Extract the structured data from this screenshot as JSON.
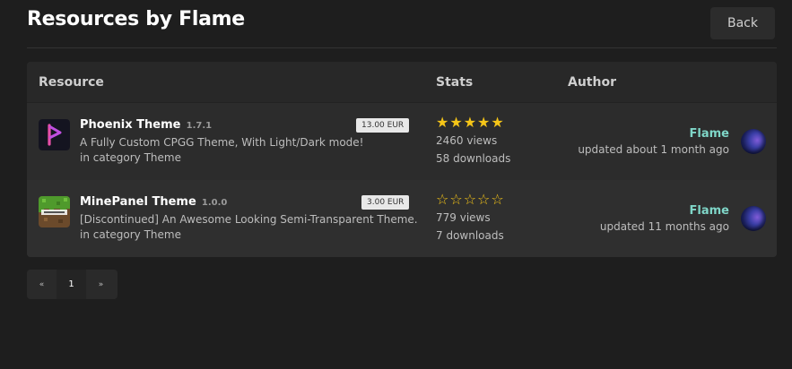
{
  "header": {
    "title": "Resources by Flame",
    "back_label": "Back"
  },
  "table": {
    "columns": [
      "Resource",
      "Stats",
      "Author"
    ],
    "rows": [
      {
        "icon": "phoenix-theme-logo",
        "name": "Phoenix Theme",
        "version": "1.7.1",
        "price": "13.00 EUR",
        "description": "A Fully Custom CPGG Theme, With Light/Dark mode!",
        "category": "in category Theme",
        "rating": 5,
        "stars": "★★★★★",
        "views": "2460 views",
        "downloads": "58 downloads",
        "author": "Flame",
        "updated": "updated about 1 month ago"
      },
      {
        "icon": "minecraft-grass-logo",
        "name": "MinePanel Theme",
        "version": "1.0.0",
        "price": "3.00 EUR",
        "description": "[Discontinued] An Awesome Looking Semi-Transparent Theme.",
        "category": "in category Theme",
        "rating": 0,
        "stars": "☆☆☆☆☆",
        "views": "779 views",
        "downloads": "7 downloads",
        "author": "Flame",
        "updated": "updated 11 months ago"
      }
    ]
  },
  "pagination": {
    "prev": "«",
    "current": "1",
    "next": "»"
  },
  "colors": {
    "background": "#1e1e1e",
    "panel": "#2a2a2a",
    "star": "#f5c518",
    "author_link": "#7fd6c8"
  }
}
